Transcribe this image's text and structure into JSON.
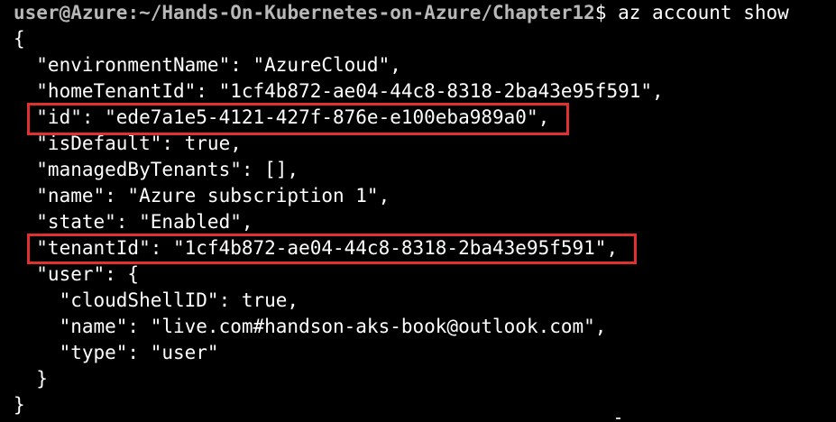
{
  "terminal": {
    "prompt": {
      "user_host": "user@Azure",
      "separator": ":",
      "path": "~/Hands-On-Kubernetes-on-Azure/Chapter12",
      "symbol": "$",
      "command": " az account show"
    },
    "output_lines": [
      "{",
      "  \"environmentName\": \"AzureCloud\",",
      "  \"homeTenantId\": \"1cf4b872-ae04-44c8-8318-2ba43e95f591\",",
      "  \"id\": \"ede7a1e5-4121-427f-876e-e100eba989a0\",",
      "  \"isDefault\": true,",
      "  \"managedByTenants\": [],",
      "  \"name\": \"Azure subscription 1\",",
      "  \"state\": \"Enabled\",",
      "  \"tenantId\": \"1cf4b872-ae04-44c8-8318-2ba43e95f591\",",
      "  \"user\": {",
      "    \"cloudShellID\": true,",
      "    \"name\": \"live.com#handson-aks-book@outlook.com\",",
      "    \"type\": \"user\"",
      "  }",
      "}"
    ]
  },
  "colors": {
    "background": "#000000",
    "text": "#ffffff",
    "prompt": "#b8b8b8",
    "highlight": "#e03030"
  }
}
